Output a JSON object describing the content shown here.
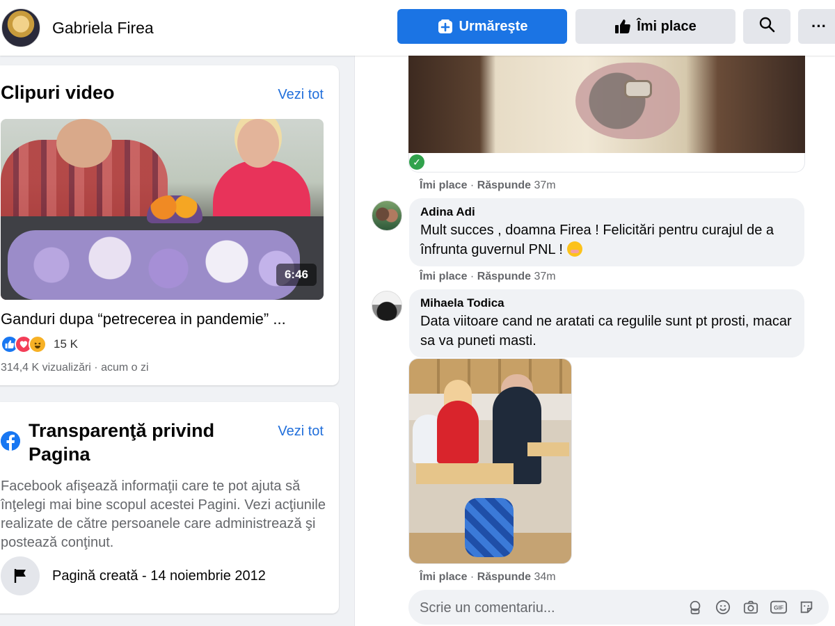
{
  "header": {
    "page_name": "Gabriela Firea",
    "follow_label": "Urmăreşte",
    "like_label": "Îmi place",
    "more_label": "···"
  },
  "videos_card": {
    "title": "Clipuri video",
    "see_all": "Vezi tot",
    "video": {
      "duration": "6:46",
      "title": "Ganduri dupa “petrecerea in pandemie” ...",
      "reaction_count": "15 K",
      "meta": "314,4 K vizualizări · acum o zi"
    }
  },
  "transparency_card": {
    "title": "Transparenţă privind Pagina",
    "see_all": "Vezi tot",
    "description": "Facebook afişează informaţii care te pot ajuta să înţelegi mai bine scopul acestei Pagini. Vezi acţiunile realizate de către persoanele care administrează şi postează conţinut.",
    "created": "Pagină creată - 14 noiembrie 2012"
  },
  "comments": [
    {
      "actions": {
        "like": "Îmi place",
        "reply": "Răspunde",
        "time": "37m"
      }
    },
    {
      "name": "Adina Adi",
      "text": "Mult succes , doamna Firea ! Felicitări pentru curajul de a înfrunta guvernul PNL !",
      "actions": {
        "like": "Îmi place",
        "reply": "Răspunde",
        "time": "37m"
      }
    },
    {
      "name": "Mihaela Todica",
      "text": "Data viitoare cand ne aratati ca regulile sunt pt prosti, macar sa va puneti masti.",
      "actions": {
        "like": "Îmi place",
        "reply": "Răspunde",
        "time": "34m"
      }
    }
  ],
  "comment_box": {
    "placeholder": "Scrie un comentariu..."
  },
  "colors": {
    "accent": "#1b74e4",
    "link": "#216fdb",
    "secondary_text": "#65676b",
    "bubble_bg": "#f0f2f5"
  },
  "icons": [
    "follow-plus-icon",
    "thumbs-up-icon",
    "search-icon",
    "facebook-logo-icon",
    "flag-icon",
    "verified-check-icon",
    "sticker-icon",
    "emoji-icon",
    "camera-icon",
    "gif-icon",
    "avatar-sticker-icon"
  ]
}
